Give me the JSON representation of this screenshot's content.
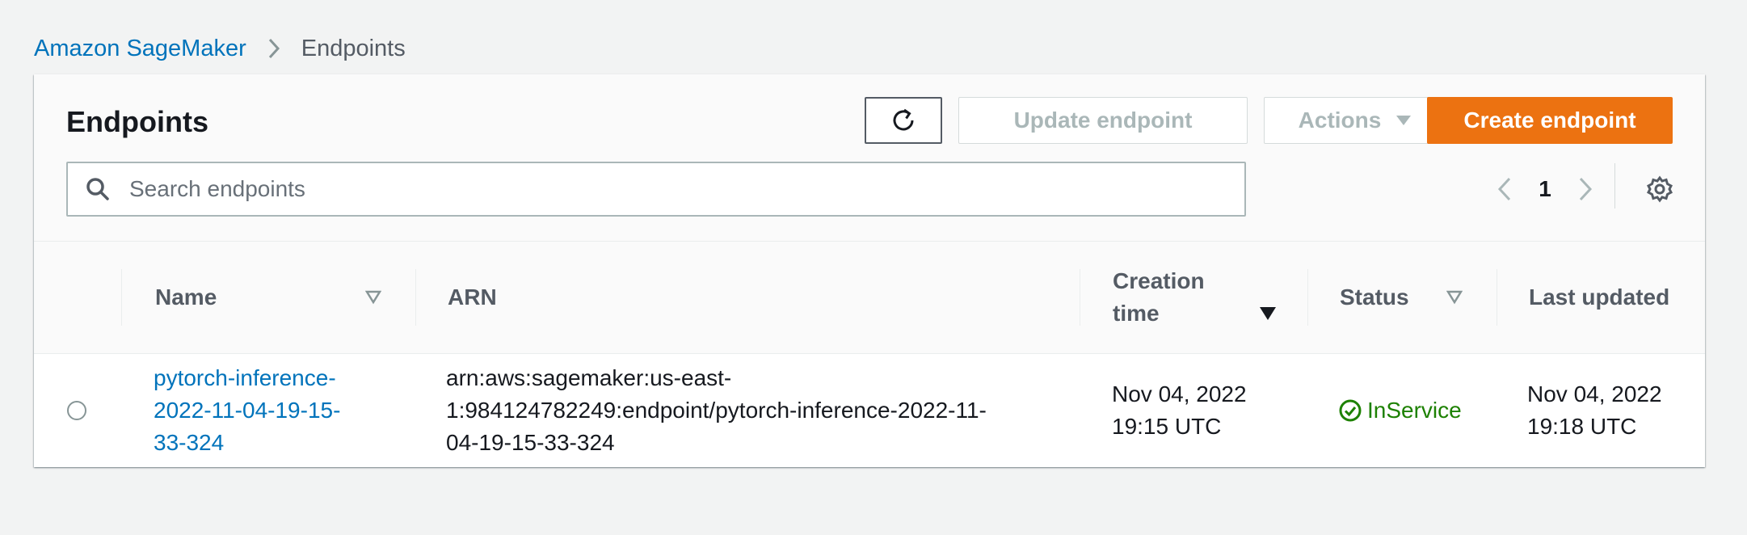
{
  "breadcrumb": {
    "root": "Amazon SageMaker",
    "current": "Endpoints"
  },
  "panel": {
    "title": "Endpoints",
    "buttons": {
      "refresh_icon": "refresh-icon",
      "update": "Update endpoint",
      "actions": "Actions",
      "create": "Create endpoint"
    },
    "search": {
      "placeholder": "Search endpoints",
      "value": ""
    },
    "pagination": {
      "current_page": "1"
    }
  },
  "table": {
    "columns": {
      "name": "Name",
      "arn": "ARN",
      "creation_time_line1": "Creation",
      "creation_time_line2": "time",
      "status": "Status",
      "last_updated": "Last updated"
    },
    "rows": [
      {
        "selected": false,
        "name_lines": [
          "pytorch-inference-",
          "2022-11-04-19-15-",
          "33-324"
        ],
        "arn_lines": [
          "arn:aws:sagemaker:us-east-",
          "1:984124782249:endpoint/pytorch-inference-2022-11-",
          "04-19-15-33-324"
        ],
        "creation_time_lines": [
          "Nov 04, 2022",
          "19:15 UTC"
        ],
        "status": "InService",
        "last_updated_lines": [
          "Nov 04, 2022",
          "19:18 UTC"
        ]
      }
    ]
  },
  "colors": {
    "accent_link": "#0073bb",
    "primary_button": "#ec7211",
    "status_ok": "#1d8102",
    "disabled_text": "#aab7b8"
  }
}
